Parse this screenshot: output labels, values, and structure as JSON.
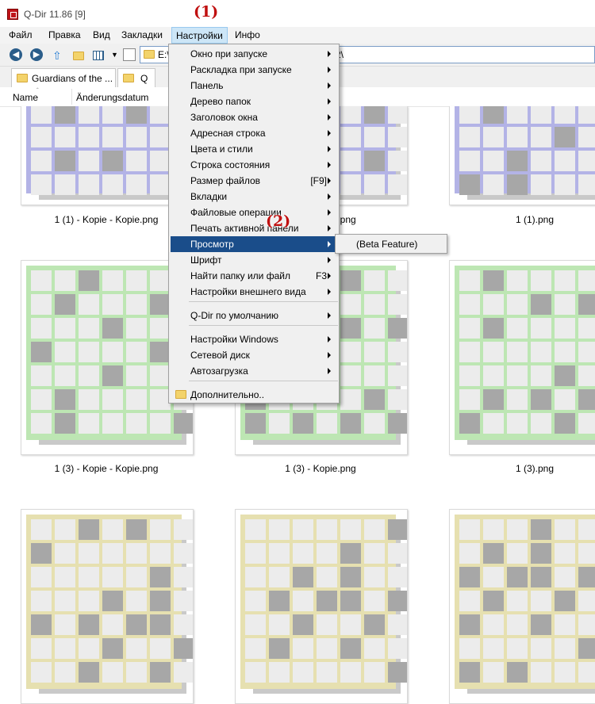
{
  "window": {
    "title": "Q-Dir 11.86 [9]",
    "markers": {
      "one": "(1)",
      "two": "(2)"
    }
  },
  "menubar": {
    "items": [
      "Файл",
      "Правка",
      "Вид",
      "Закладки",
      "Настройки",
      "Инфо"
    ],
    "active": "Настройки"
  },
  "address": {
    "value_left": "E:\\",
    "value_right": "2\\"
  },
  "tabs": [
    {
      "label": "Guardians of the ..."
    },
    {
      "label": "Q"
    }
  ],
  "columns": [
    "Name",
    "Änderungsdatum"
  ],
  "settings_menu": {
    "items": [
      {
        "label": "Окно при запуске",
        "submenu": true
      },
      {
        "label": "Раскладка при запуске",
        "submenu": true
      },
      {
        "label": "Панель",
        "submenu": true
      },
      {
        "label": "Дерево папок",
        "submenu": true
      },
      {
        "label": "Заголовок окна",
        "submenu": true
      },
      {
        "label": "Адресная строка",
        "submenu": true
      },
      {
        "label": "Цвета и стили",
        "submenu": true
      },
      {
        "label": "Строка состояния",
        "submenu": true
      },
      {
        "label": "Размер файлов",
        "shortcut": "[F9]",
        "submenu": true
      },
      {
        "label": "Вкладки",
        "submenu": true
      },
      {
        "label": "Файловые операции",
        "submenu": true
      },
      {
        "label": "Печать активной панели",
        "submenu": true
      },
      {
        "label": "Просмотр",
        "submenu": true,
        "highlighted": true
      },
      {
        "label": "Шрифт",
        "submenu": true
      },
      {
        "label": "Найти папку или файл",
        "shortcut": "F3",
        "submenu": true
      },
      {
        "label": "Настройки внешнего вида",
        "submenu": true
      },
      {
        "label": "Q-Dir по умолчанию",
        "submenu": true
      },
      {
        "label": "Настройки Windows",
        "submenu": true
      },
      {
        "label": "Сетевой диск",
        "submenu": true
      },
      {
        "label": "Автозагрузка",
        "submenu": true
      },
      {
        "label": "Дополнительно..",
        "icon": "folder-icon"
      }
    ],
    "submenu_item": "(Beta Feature)"
  },
  "files": [
    {
      "name": "1 (1) - Kopie - Kopie.png",
      "color": "#b3b3e6"
    },
    {
      "name": "1 (1) - Kopie.png",
      "color": "#b3b3e6"
    },
    {
      "name": "1 (1).png",
      "color": "#b3b3e6"
    },
    {
      "name": "1 (3) - Kopie - Kopie.png",
      "color": "#bde6b3"
    },
    {
      "name": "1 (3) - Kopie.png",
      "color": "#bde6b3"
    },
    {
      "name": "1 (3).png",
      "color": "#bde6b3"
    },
    {
      "name": "",
      "color": "#e6e0b0"
    },
    {
      "name": "",
      "color": "#e6e0b0"
    },
    {
      "name": "",
      "color": "#e6e0b0"
    }
  ],
  "colors": {
    "highlight": "#1a4d8a",
    "menubar_active": "#cde6f7",
    "marker": "#c01010"
  }
}
